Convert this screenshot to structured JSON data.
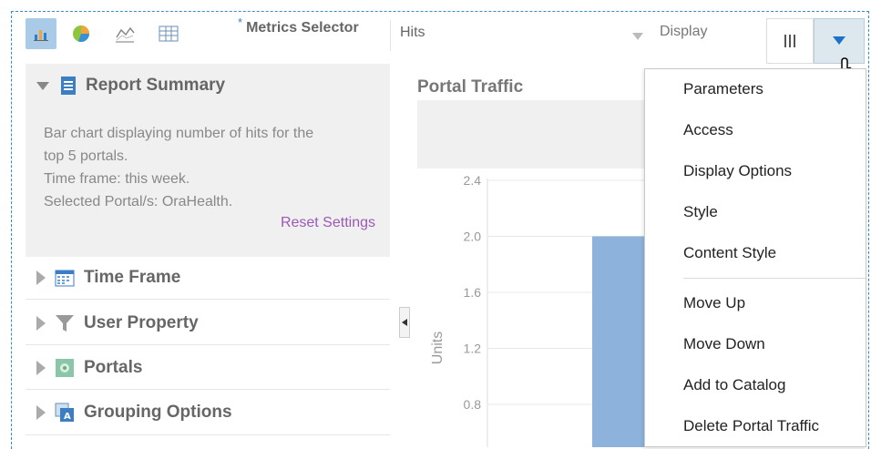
{
  "toolbar": {
    "icons": [
      "bar-chart-icon",
      "pie-chart-icon",
      "line-chart-icon",
      "table-icon"
    ],
    "metrics_required_mark": "*",
    "metrics_label": "Metrics Selector",
    "metrics_value": "Hits",
    "display_label": "Display"
  },
  "panel": {
    "summary": {
      "title": "Report Summary",
      "line1": "Bar chart displaying number of hits for the",
      "line2": "top 5 portals.",
      "line3": "Time frame: this week.",
      "line4": "Selected Portal/s: OraHealth.",
      "reset": "Reset Settings"
    },
    "sections": [
      "Time Frame",
      "User Property",
      "Portals",
      "Grouping Options"
    ]
  },
  "chart": {
    "title": "Portal Traffic",
    "ylabel": "Units",
    "yticks": [
      "2.4",
      "2.0",
      "1.6",
      "1.2",
      "0.8"
    ]
  },
  "chart_data": {
    "type": "bar",
    "title": "Portal Traffic",
    "ylabel": "Units",
    "yticks": [
      2.4,
      2.0,
      1.6,
      1.2,
      0.8
    ],
    "values": [
      2.0
    ],
    "colors": {
      "bar": "#8db3dd"
    }
  },
  "menu": {
    "group1": [
      "Parameters",
      "Access",
      "Display Options",
      "Style",
      "Content Style"
    ],
    "group2": [
      "Move Up",
      "Move Down",
      "Add to Catalog",
      "Delete Portal Traffic"
    ]
  },
  "colors": {
    "accent": "#2f8fc9",
    "link": "#9b59b6",
    "menu_arrow": "#1a73c9"
  }
}
